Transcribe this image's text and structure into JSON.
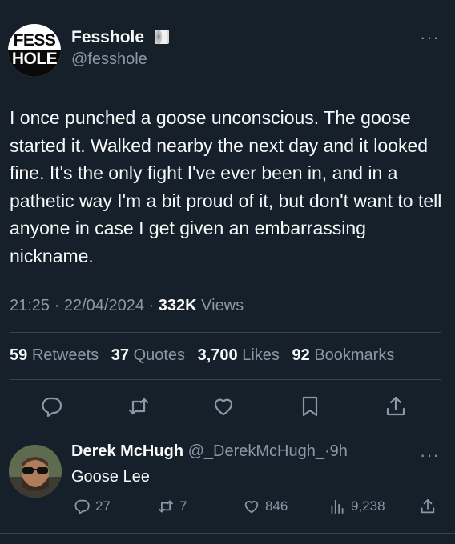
{
  "tweet": {
    "author": {
      "avatar_line1": "FESS",
      "avatar_line2": "HOLE",
      "name": "Fesshole",
      "handle": "@fesshole",
      "badge_icon": "toilet-roll-icon"
    },
    "more_label": "···",
    "text": "I once punched a goose unconscious. The goose started it. Walked nearby the next day and it looked fine. It's the only fight I've ever been in, and in a pathetic way I'm a bit proud of it, but don't want to tell anyone in case I get given an embarrassing nickname.",
    "time": "21:25",
    "sep1": "·",
    "date": "22/04/2024",
    "sep2": "·",
    "views_count": "332K",
    "views_label": "Views",
    "stats": {
      "retweets_count": "59",
      "retweets_label": "Retweets",
      "quotes_count": "37",
      "quotes_label": "Quotes",
      "likes_count": "3,700",
      "likes_label": "Likes",
      "bookmarks_count": "92",
      "bookmarks_label": "Bookmarks"
    },
    "actions": [
      "reply-icon",
      "retweet-icon",
      "like-icon",
      "bookmark-icon",
      "share-icon"
    ]
  },
  "reply": {
    "name": "Derek McHugh",
    "handle": "@_DerekMcHugh_",
    "sep": "·",
    "age": "9h",
    "more_label": "···",
    "text": "Goose Lee",
    "replies": "27",
    "retweets": "7",
    "likes": "846",
    "views": "9,238"
  },
  "colors": {
    "background": "#15202b",
    "text_primary": "#f7f9f9",
    "text_secondary": "#8b98a5",
    "divider": "#38444d"
  }
}
